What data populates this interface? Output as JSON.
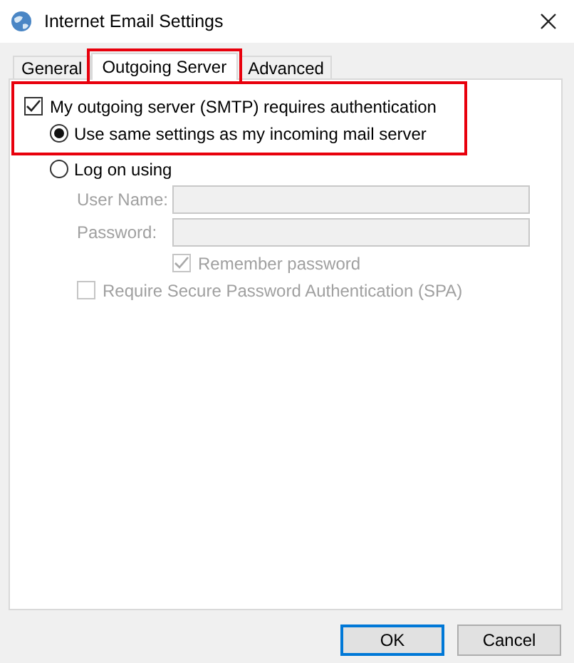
{
  "window": {
    "title": "Internet Email Settings"
  },
  "tabs": [
    {
      "label": "General",
      "selected": false,
      "highlighted": false
    },
    {
      "label": "Outgoing Server",
      "selected": true,
      "highlighted": true
    },
    {
      "label": "Advanced",
      "selected": false,
      "highlighted": false
    }
  ],
  "auth": {
    "highlighted": true,
    "label": "My outgoing server (SMTP) requires authentication",
    "checked": true
  },
  "options": [
    {
      "label": "Use same settings as my incoming mail server",
      "selected": true
    },
    {
      "label": "Log on using",
      "selected": false
    }
  ],
  "fields": [
    {
      "label": "User Name:",
      "disabled": true
    },
    {
      "label": "Password:",
      "disabled": true
    }
  ],
  "remember": {
    "label": "Remember password",
    "checked": true,
    "disabled": true
  },
  "spa": {
    "label": "Require Secure Password Authentication (SPA)",
    "checked": false,
    "disabled": true
  },
  "buttons": [
    {
      "label": "OK",
      "default": true
    },
    {
      "label": "Cancel",
      "default": false
    }
  ]
}
